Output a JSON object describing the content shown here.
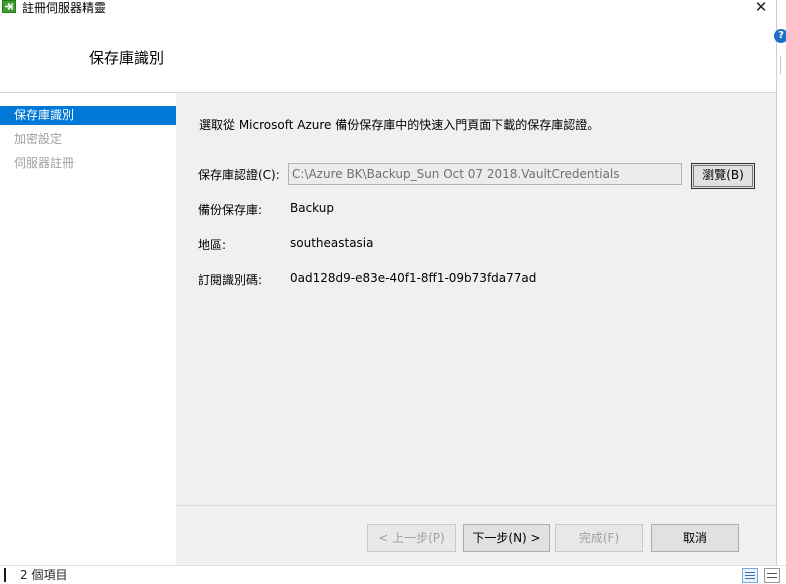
{
  "window": {
    "title": "註冊伺服器精靈",
    "close_glyph": "✕",
    "page_title": "保存庫識別"
  },
  "sidebar": {
    "items": [
      {
        "label": "保存庫識別",
        "active": true
      },
      {
        "label": "加密設定",
        "active": false
      },
      {
        "label": "伺服器註冊",
        "active": false
      }
    ]
  },
  "content": {
    "instruction": "選取從 Microsoft Azure 備份保存庫中的快速入門頁面下載的保存庫認證。",
    "credentials_label": "保存庫認證(C):",
    "credentials_value": "C:\\Azure BK\\Backup_Sun Oct 07 2018.VaultCredentials",
    "browse_label": "瀏覽(B)",
    "vault_label": "備份保存庫:",
    "vault_value": "Backup",
    "region_label": "地區:",
    "region_value": "southeastasia",
    "subscription_label": "訂閱識別碼:",
    "subscription_value": "0ad128d9-e83e-40f1-8ff1-09b73fda77ad"
  },
  "footer": {
    "prev_label": "< 上一步(P)",
    "next_label": "下一步(N) >",
    "finish_label": "完成(F)",
    "cancel_label": "取消"
  },
  "statusbar": {
    "count_text": "2 個項目"
  },
  "icons": {
    "app": "wizard-arrow-icon",
    "help": "help-icon",
    "view_grid": "details-view-icon",
    "view_list": "list-view-icon"
  },
  "colors": {
    "accent": "#0078d7",
    "app_icon": "#3c9c2e",
    "panel_bg": "#f0f0f0"
  }
}
